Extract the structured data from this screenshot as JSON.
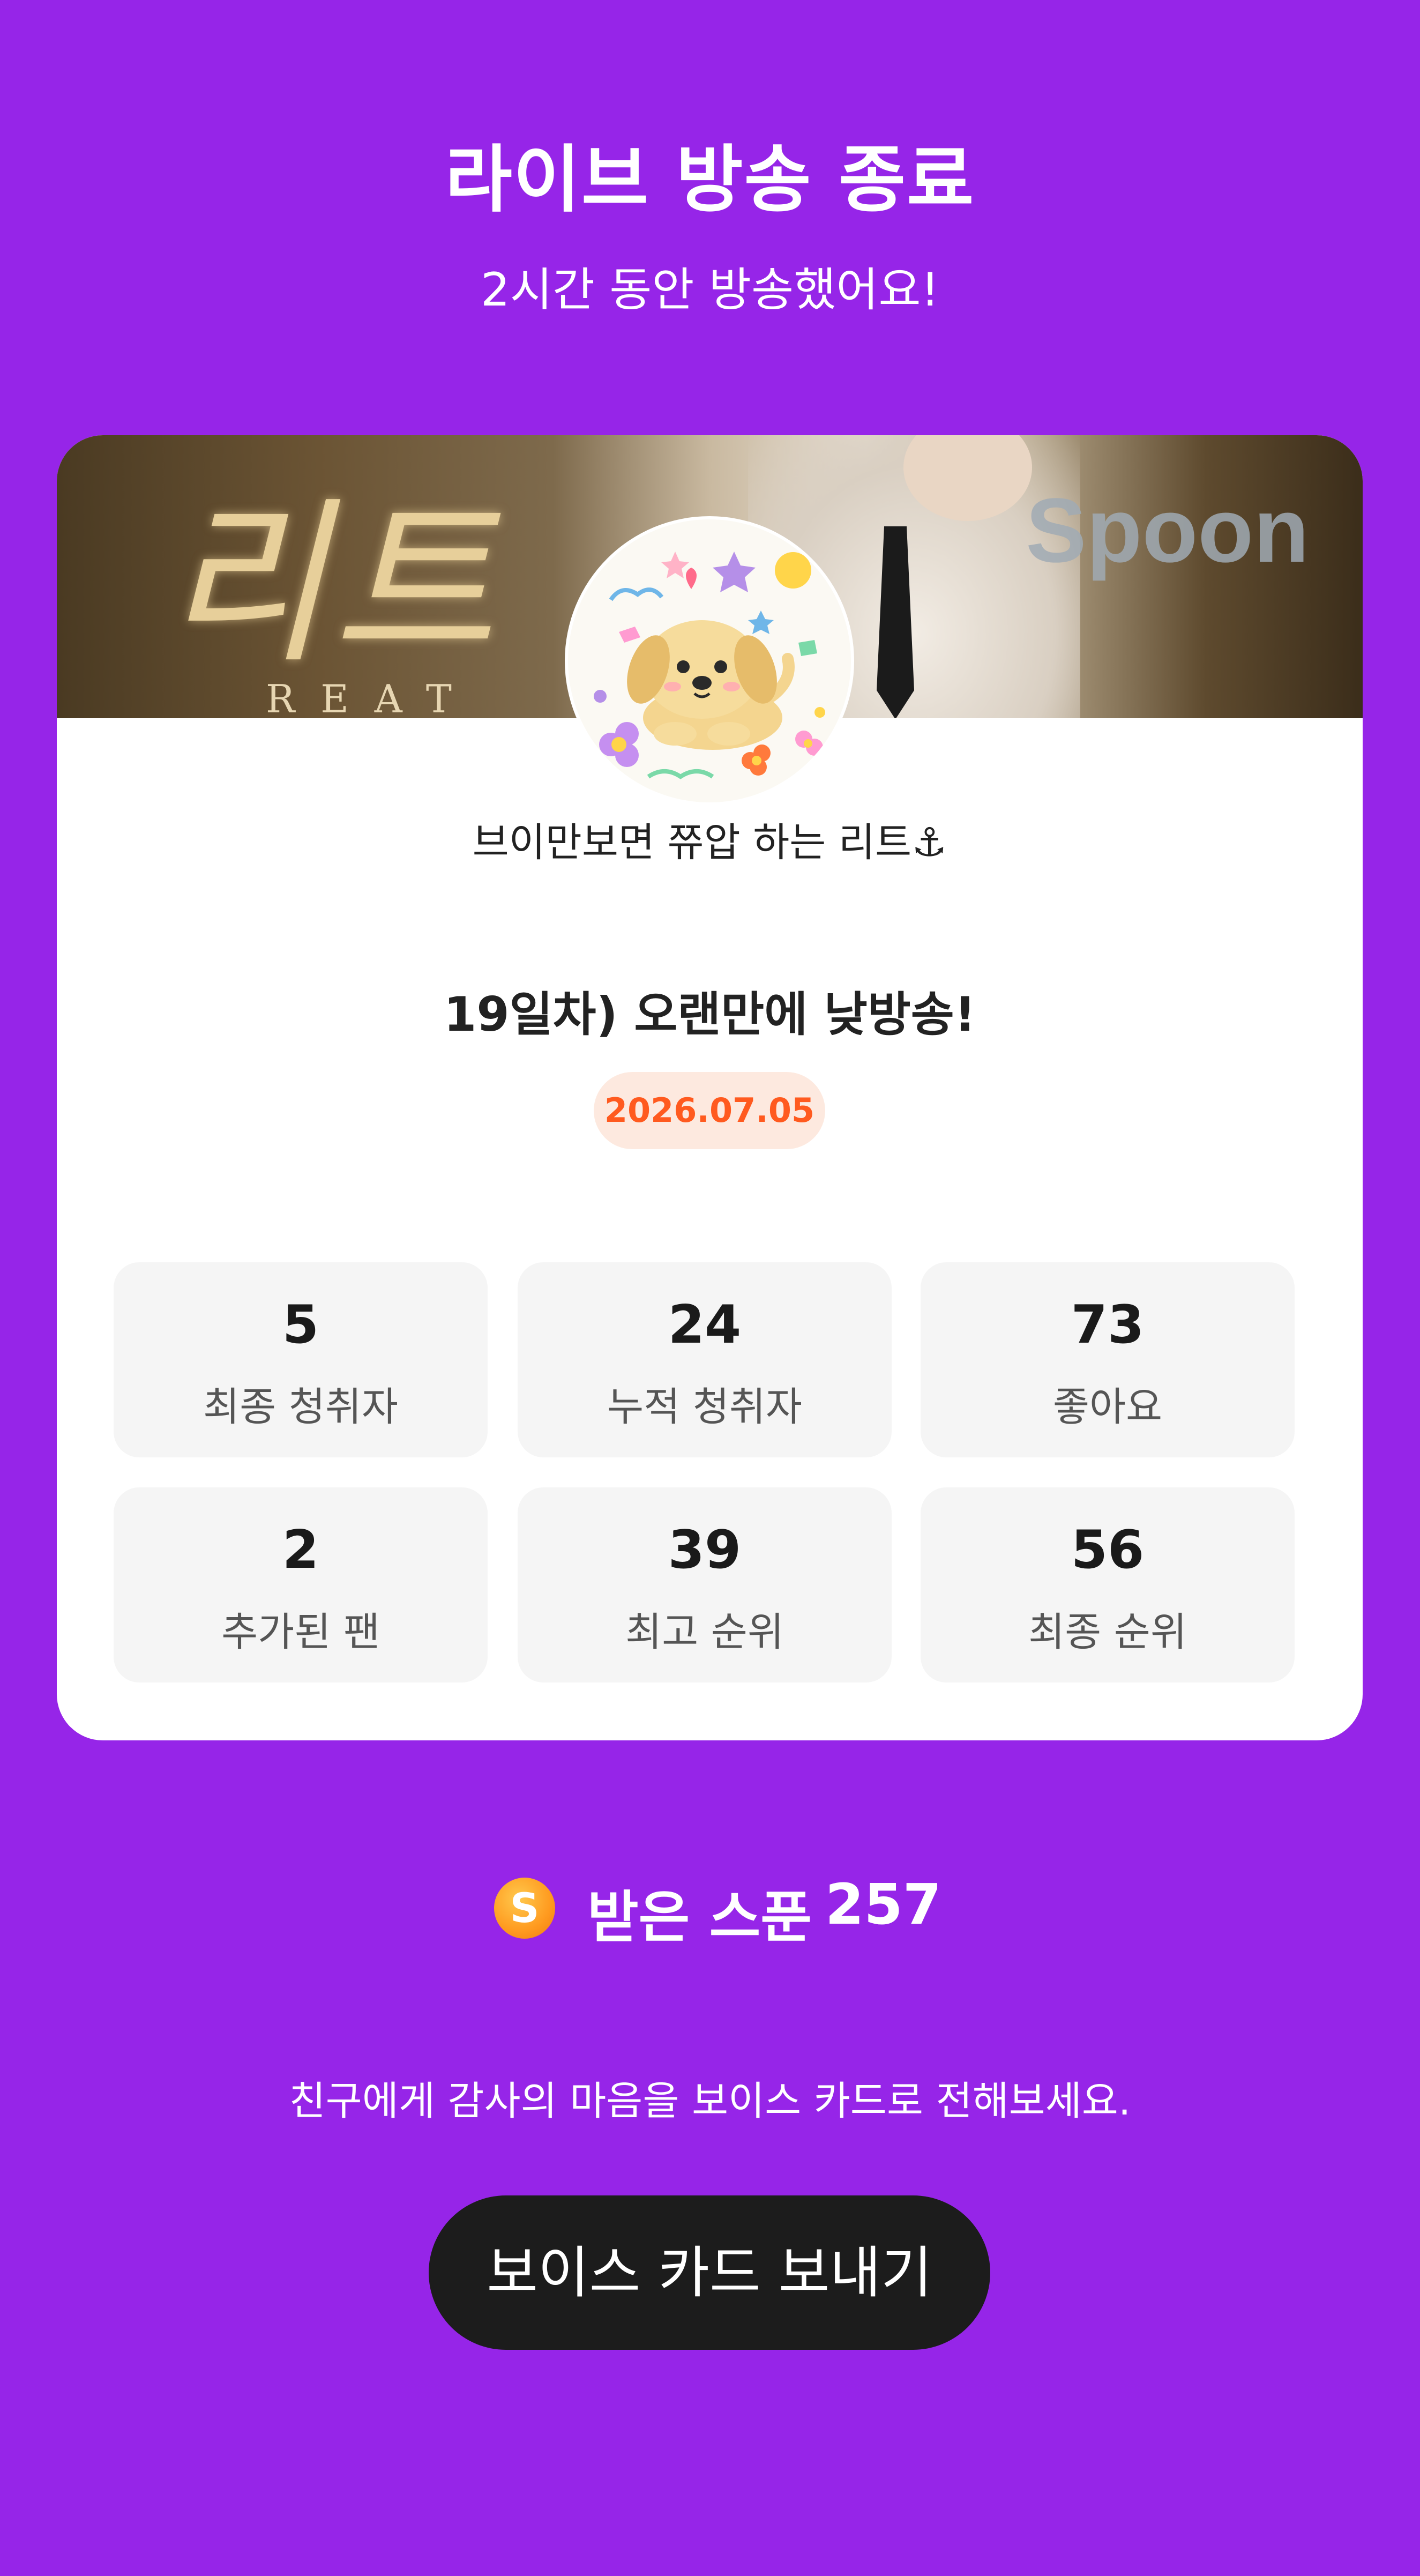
{
  "header": {
    "title": "라이브 방송 종료",
    "subtitle": "2시간 동안 방송했어요!"
  },
  "card": {
    "banner": {
      "title": "리트",
      "subtitle": "REAT",
      "logo": "Spoon"
    },
    "avatar_icon": "puppy-avatar-icon",
    "username": "브이만보면 쮸압 하는 리트⚓",
    "broadcast_title": "19일차) 오랜만에 낮방송!",
    "date": "2026.07.05",
    "stats": [
      {
        "value": "5",
        "label": "최종 청취자"
      },
      {
        "value": "24",
        "label": "누적 청취자"
      },
      {
        "value": "73",
        "label": "좋아요"
      },
      {
        "value": "2",
        "label": "추가된 팬"
      },
      {
        "value": "39",
        "label": "최고 순위"
      },
      {
        "value": "56",
        "label": "최종 순위"
      }
    ]
  },
  "spoons": {
    "icon": "spoon-coin-icon",
    "icon_glyph": "S",
    "label": "받은 스푼",
    "count": "257"
  },
  "thanks_text": "친구에게 감사의 마음을 보이스 카드로 전해보세요.",
  "voice_card_button": "보이스 카드 보내기",
  "colors": {
    "background": "#9625E8",
    "date_badge_bg": "#FDE9DF",
    "date_badge_text": "#FF5A1F",
    "button_bg": "#1C1C1C"
  }
}
